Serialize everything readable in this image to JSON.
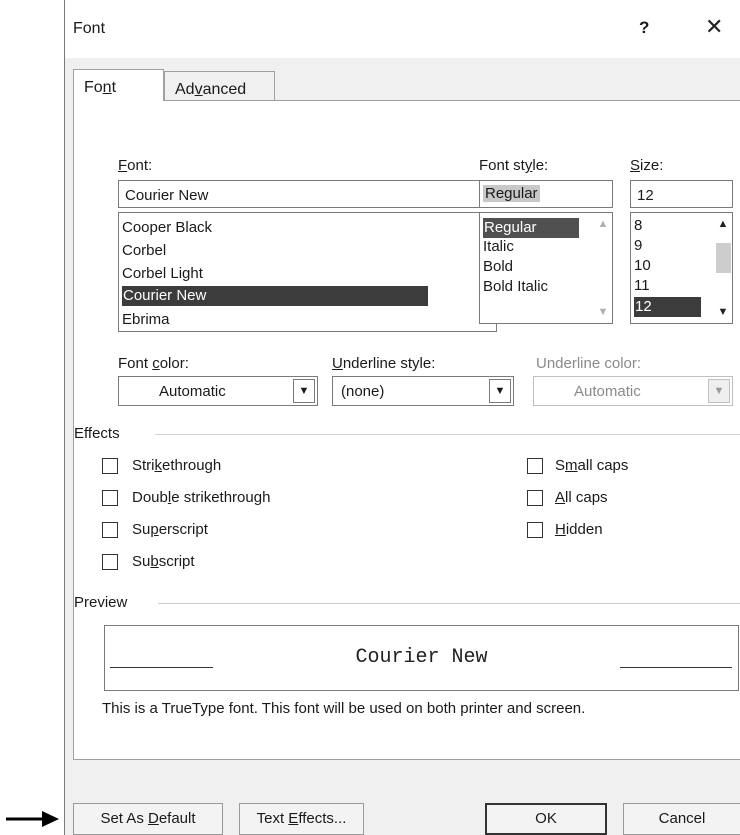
{
  "dialog": {
    "title": "Font",
    "help": "?",
    "close": "✕"
  },
  "tabs": [
    {
      "pre": "Fo",
      "key": "n",
      "post": "t"
    },
    {
      "pre": "Ad",
      "key": "v",
      "post": "anced"
    }
  ],
  "font": {
    "label_key": "F",
    "label_post": "ont:",
    "value": "Courier New",
    "items": [
      "Cooper Black",
      "Corbel",
      "Corbel Light",
      "Courier New",
      "Ebrima"
    ],
    "selected": "Courier New"
  },
  "style": {
    "label_pre": "Font st",
    "label_key": "y",
    "label_post": "le:",
    "value": "Regular",
    "items": [
      "Regular",
      "Italic",
      "Bold",
      "Bold Italic"
    ],
    "selected": "Regular"
  },
  "size": {
    "label_key": "S",
    "label_post": "ize:",
    "value": "12",
    "items": [
      "8",
      "9",
      "10",
      "11",
      "12"
    ],
    "selected": "12"
  },
  "font_color": {
    "label_pre": "Font ",
    "label_key": "c",
    "label_post": "olor:",
    "value": "Automatic"
  },
  "underline_style": {
    "label_key": "U",
    "label_post": "nderline style:",
    "value": "(none)"
  },
  "underline_color": {
    "label": "Underline color:",
    "value": "Automatic"
  },
  "effects": {
    "title": "Effects",
    "items": [
      {
        "pre": "Stri",
        "key": "k",
        "post": "ethrough"
      },
      {
        "pre": "Doub",
        "key": "l",
        "post": "e strikethrough"
      },
      {
        "pre": "Su",
        "key": "p",
        "post": "erscript"
      },
      {
        "pre": "Su",
        "key": "b",
        "post": "script"
      },
      {
        "pre": "S",
        "key": "m",
        "post": "all caps"
      },
      {
        "pre": "",
        "key": "A",
        "post": "ll caps"
      },
      {
        "pre": "",
        "key": "H",
        "post": "idden"
      }
    ]
  },
  "preview": {
    "title": "Preview",
    "text": "Courier New",
    "note": "This is a TrueType font. This font will be used on both printer and screen."
  },
  "buttons": {
    "set_default": {
      "pre": "Set As ",
      "key": "D",
      "post": "efault"
    },
    "text_effects": {
      "pre": "Text ",
      "key": "E",
      "post": "ffects..."
    },
    "ok": "OK",
    "cancel": "Cancel"
  }
}
